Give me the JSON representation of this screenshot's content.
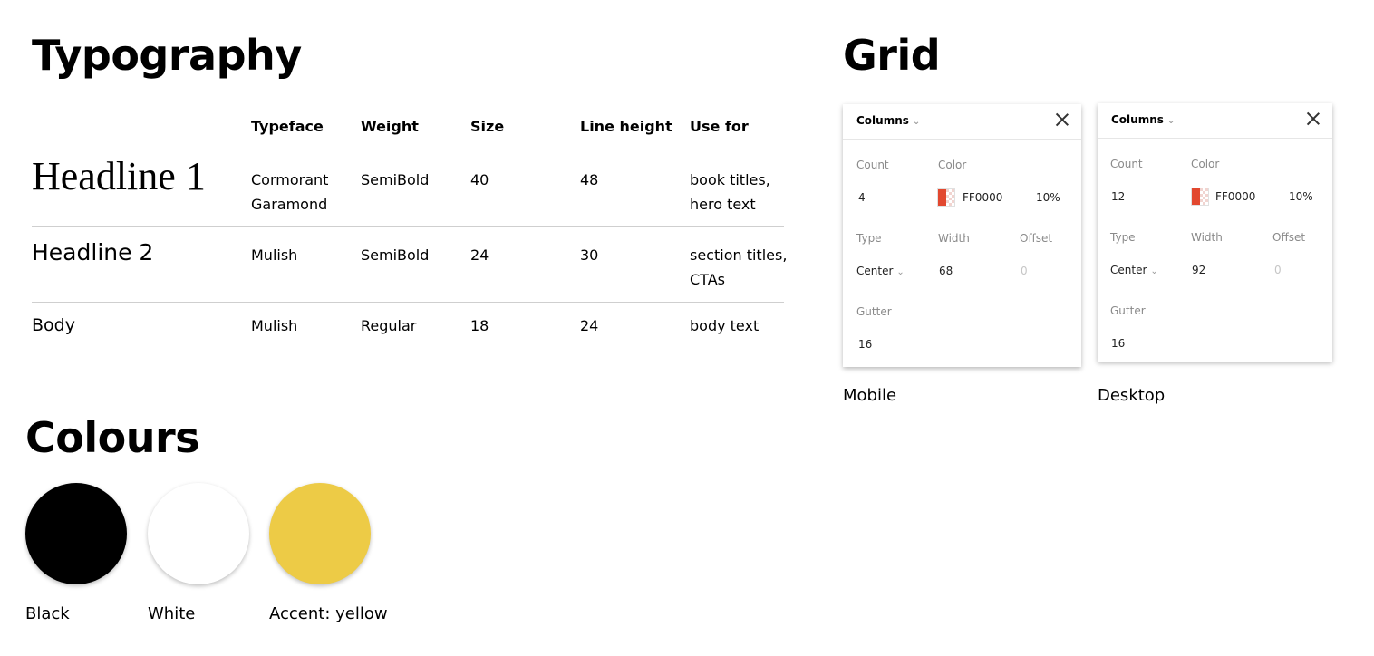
{
  "typography": {
    "title": "Typography",
    "headers": {
      "typeface": "Typeface",
      "weight": "Weight",
      "size": "Size",
      "line_height": "Line height",
      "use_for": "Use for"
    },
    "rows": [
      {
        "name": "Headline 1",
        "typeface_1": "Cormorant",
        "typeface_2": "Garamond",
        "weight": "SemiBold",
        "size": "40",
        "line_height": "48",
        "use_1": "book titles,",
        "use_2": "hero text"
      },
      {
        "name": "Headline 2",
        "typeface": "Mulish",
        "weight": "SemiBold",
        "size": "24",
        "line_height": "30",
        "use_1": "section titles,",
        "use_2": "CTAs"
      },
      {
        "name": "Body",
        "typeface": "Mulish",
        "weight": "Regular",
        "size": "18",
        "line_height": "24",
        "use_1": "body text"
      }
    ]
  },
  "colours": {
    "title": "Colours",
    "swatches": [
      {
        "label": "Black",
        "color": "#000000"
      },
      {
        "label": "White",
        "color": "#ffffff"
      },
      {
        "label": "Accent: yellow",
        "color": "#edcb46"
      }
    ]
  },
  "grid": {
    "title": "Grid",
    "labels": {
      "columns": "Columns",
      "count": "Count",
      "color": "Color",
      "type": "Type",
      "width": "Width",
      "offset": "Offset",
      "gutter": "Gutter"
    },
    "panels": [
      {
        "caption": "Mobile",
        "count": "4",
        "color_hex": "FF0000",
        "opacity": "10%",
        "type": "Center",
        "width": "68",
        "offset": "0",
        "gutter": "16"
      },
      {
        "caption": "Desktop",
        "count": "12",
        "color_hex": "FF0000",
        "opacity": "10%",
        "type": "Center",
        "width": "92",
        "offset": "0",
        "gutter": "16"
      }
    ]
  },
  "icons": {
    "chevron": "chevron-down-icon",
    "close": "close-icon"
  }
}
